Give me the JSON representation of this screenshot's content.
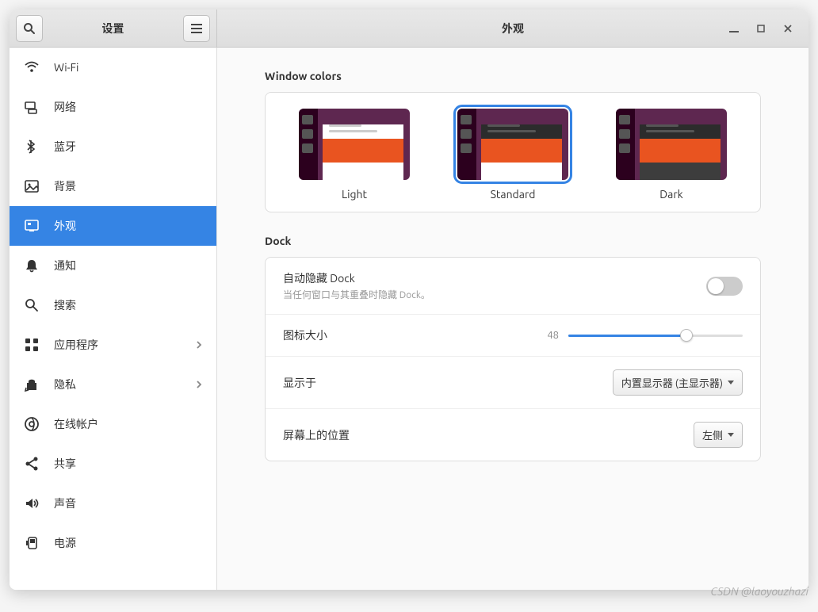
{
  "header": {
    "sidebar_title": "设置",
    "page_title": "外观"
  },
  "sidebar": {
    "items": [
      {
        "icon": "wifi",
        "label": "Wi-Fi"
      },
      {
        "icon": "network",
        "label": "网络"
      },
      {
        "icon": "bluetooth",
        "label": "蓝牙"
      },
      {
        "icon": "background",
        "label": "背景"
      },
      {
        "icon": "appearance",
        "label": "外观",
        "active": true
      },
      {
        "icon": "notifications",
        "label": "通知"
      },
      {
        "icon": "search",
        "label": "搜索"
      },
      {
        "icon": "apps",
        "label": "应用程序",
        "chevron": true
      },
      {
        "icon": "privacy",
        "label": "隐私",
        "chevron": true
      },
      {
        "icon": "accounts",
        "label": "在线帐户"
      },
      {
        "icon": "share",
        "label": "共享"
      },
      {
        "icon": "sound",
        "label": "声音"
      },
      {
        "icon": "power",
        "label": "电源"
      }
    ]
  },
  "sections": {
    "window_colors": {
      "title": "Window colors",
      "options": [
        {
          "label": "Light",
          "selected": false
        },
        {
          "label": "Standard",
          "selected": true
        },
        {
          "label": "Dark",
          "selected": false
        }
      ]
    },
    "dock": {
      "title": "Dock",
      "auto_hide": {
        "label": "自动隐藏 Dock",
        "sub": "当任何窗口与其重叠时隐藏 Dock。",
        "value": false
      },
      "icon_size": {
        "label": "图标大小",
        "value": "48"
      },
      "show_on": {
        "label": "显示于",
        "value": "内置显示器 (主显示器)"
      },
      "position": {
        "label": "屏幕上的位置",
        "value": "左侧"
      }
    }
  },
  "watermark": "CSDN @laoyouzhazi"
}
